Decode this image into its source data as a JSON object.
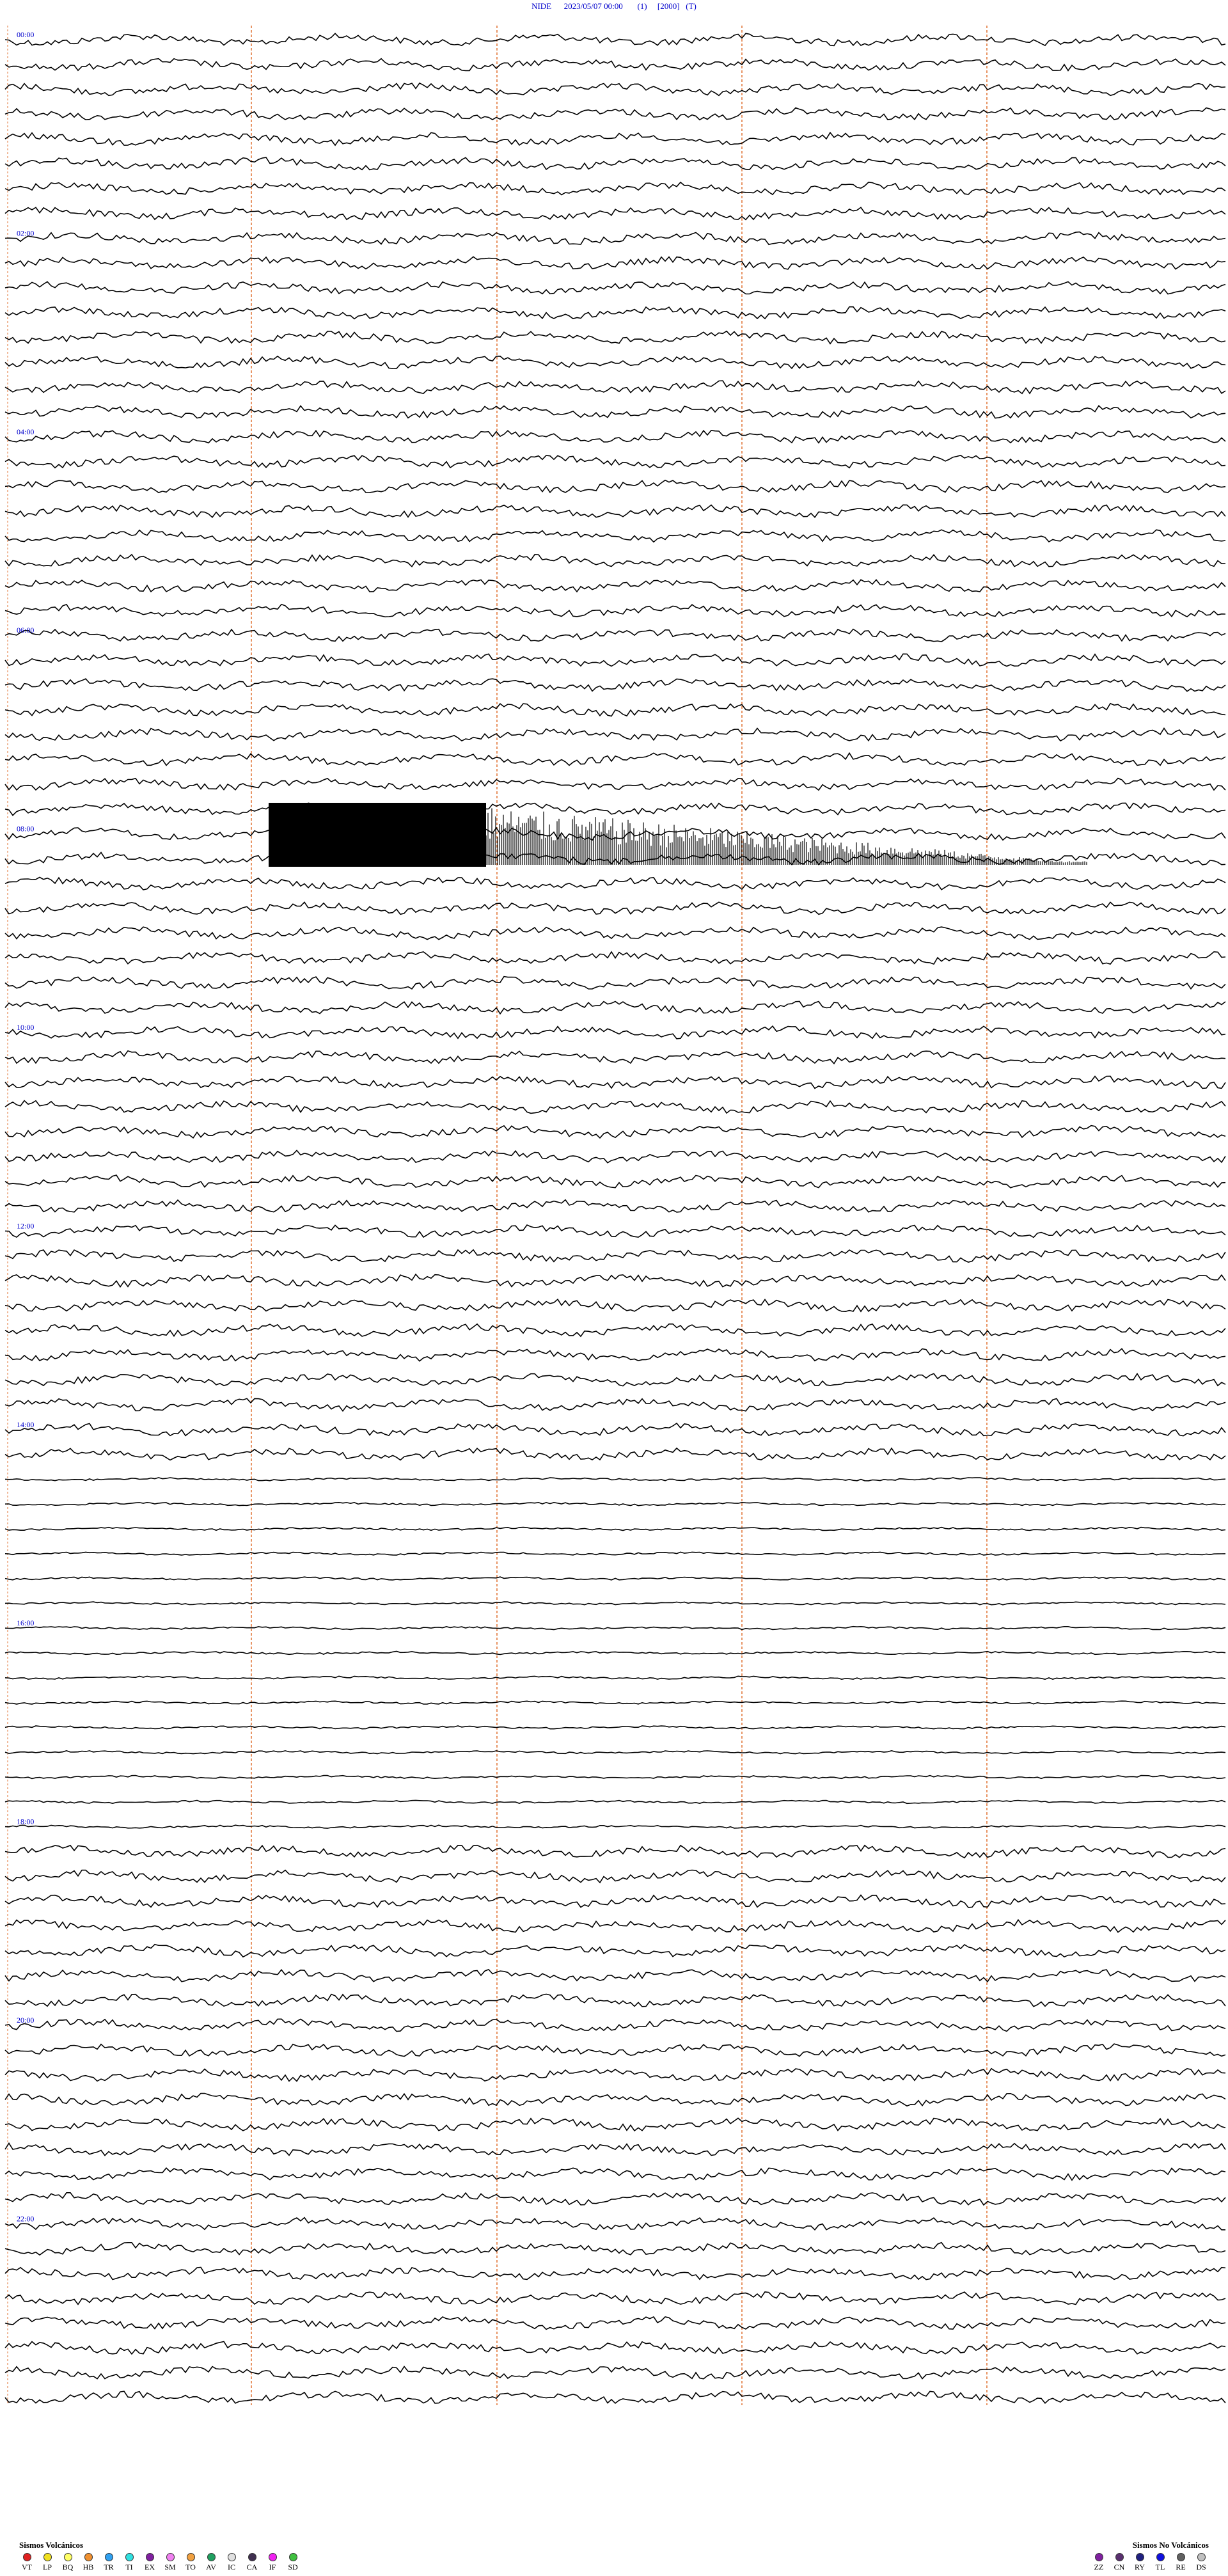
{
  "title": "NIDE      2023/05/07 00:00       (1)     [2000]   (T)",
  "chart_data": {
    "type": "line",
    "station": "NIDE",
    "start": "2023/05/07 00:00",
    "hour_labels": [
      "00:00",
      "02:00",
      "04:00",
      "06:00",
      "08:00",
      "10:00",
      "12:00",
      "14:00",
      "16:00",
      "18:00",
      "20:00",
      "22:00",
      "00:00"
    ],
    "trace_count": 96,
    "color": "#000000",
    "marker_line_color": "#e07030",
    "hour_label_color": "#0000cc"
  },
  "legend_volcanic": {
    "title": "Sismos Volcánicos",
    "items": [
      {
        "code": "VT",
        "color": "#e02020"
      },
      {
        "code": "LP",
        "color": "#f0e020"
      },
      {
        "code": "BQ",
        "color": "#ffff66"
      },
      {
        "code": "HB",
        "color": "#f09030"
      },
      {
        "code": "TR",
        "color": "#30a0f0"
      },
      {
        "code": "TI",
        "color": "#30e0e0"
      },
      {
        "code": "EX",
        "color": "#8020a0"
      },
      {
        "code": "SM",
        "color": "#f080f0"
      },
      {
        "code": "TO",
        "color": "#f0a040"
      },
      {
        "code": "AV",
        "color": "#20a060"
      },
      {
        "code": "IC",
        "color": "#e0e0e0"
      },
      {
        "code": "CA",
        "color": "#403050"
      },
      {
        "code": "IF",
        "color": "#f020f0"
      },
      {
        "code": "SD",
        "color": "#40c040"
      }
    ]
  },
  "legend_nonvolcanic": {
    "title": "Sismos No Volcánicos",
    "items": [
      {
        "code": "ZZ",
        "color": "#8020a0"
      },
      {
        "code": "CN",
        "color": "#5a3070"
      },
      {
        "code": "RY",
        "color": "#202080"
      },
      {
        "code": "TL",
        "color": "#1010e0"
      },
      {
        "code": "RE",
        "color": "#606060"
      },
      {
        "code": "DS",
        "color": "#c0c0c0"
      }
    ]
  }
}
